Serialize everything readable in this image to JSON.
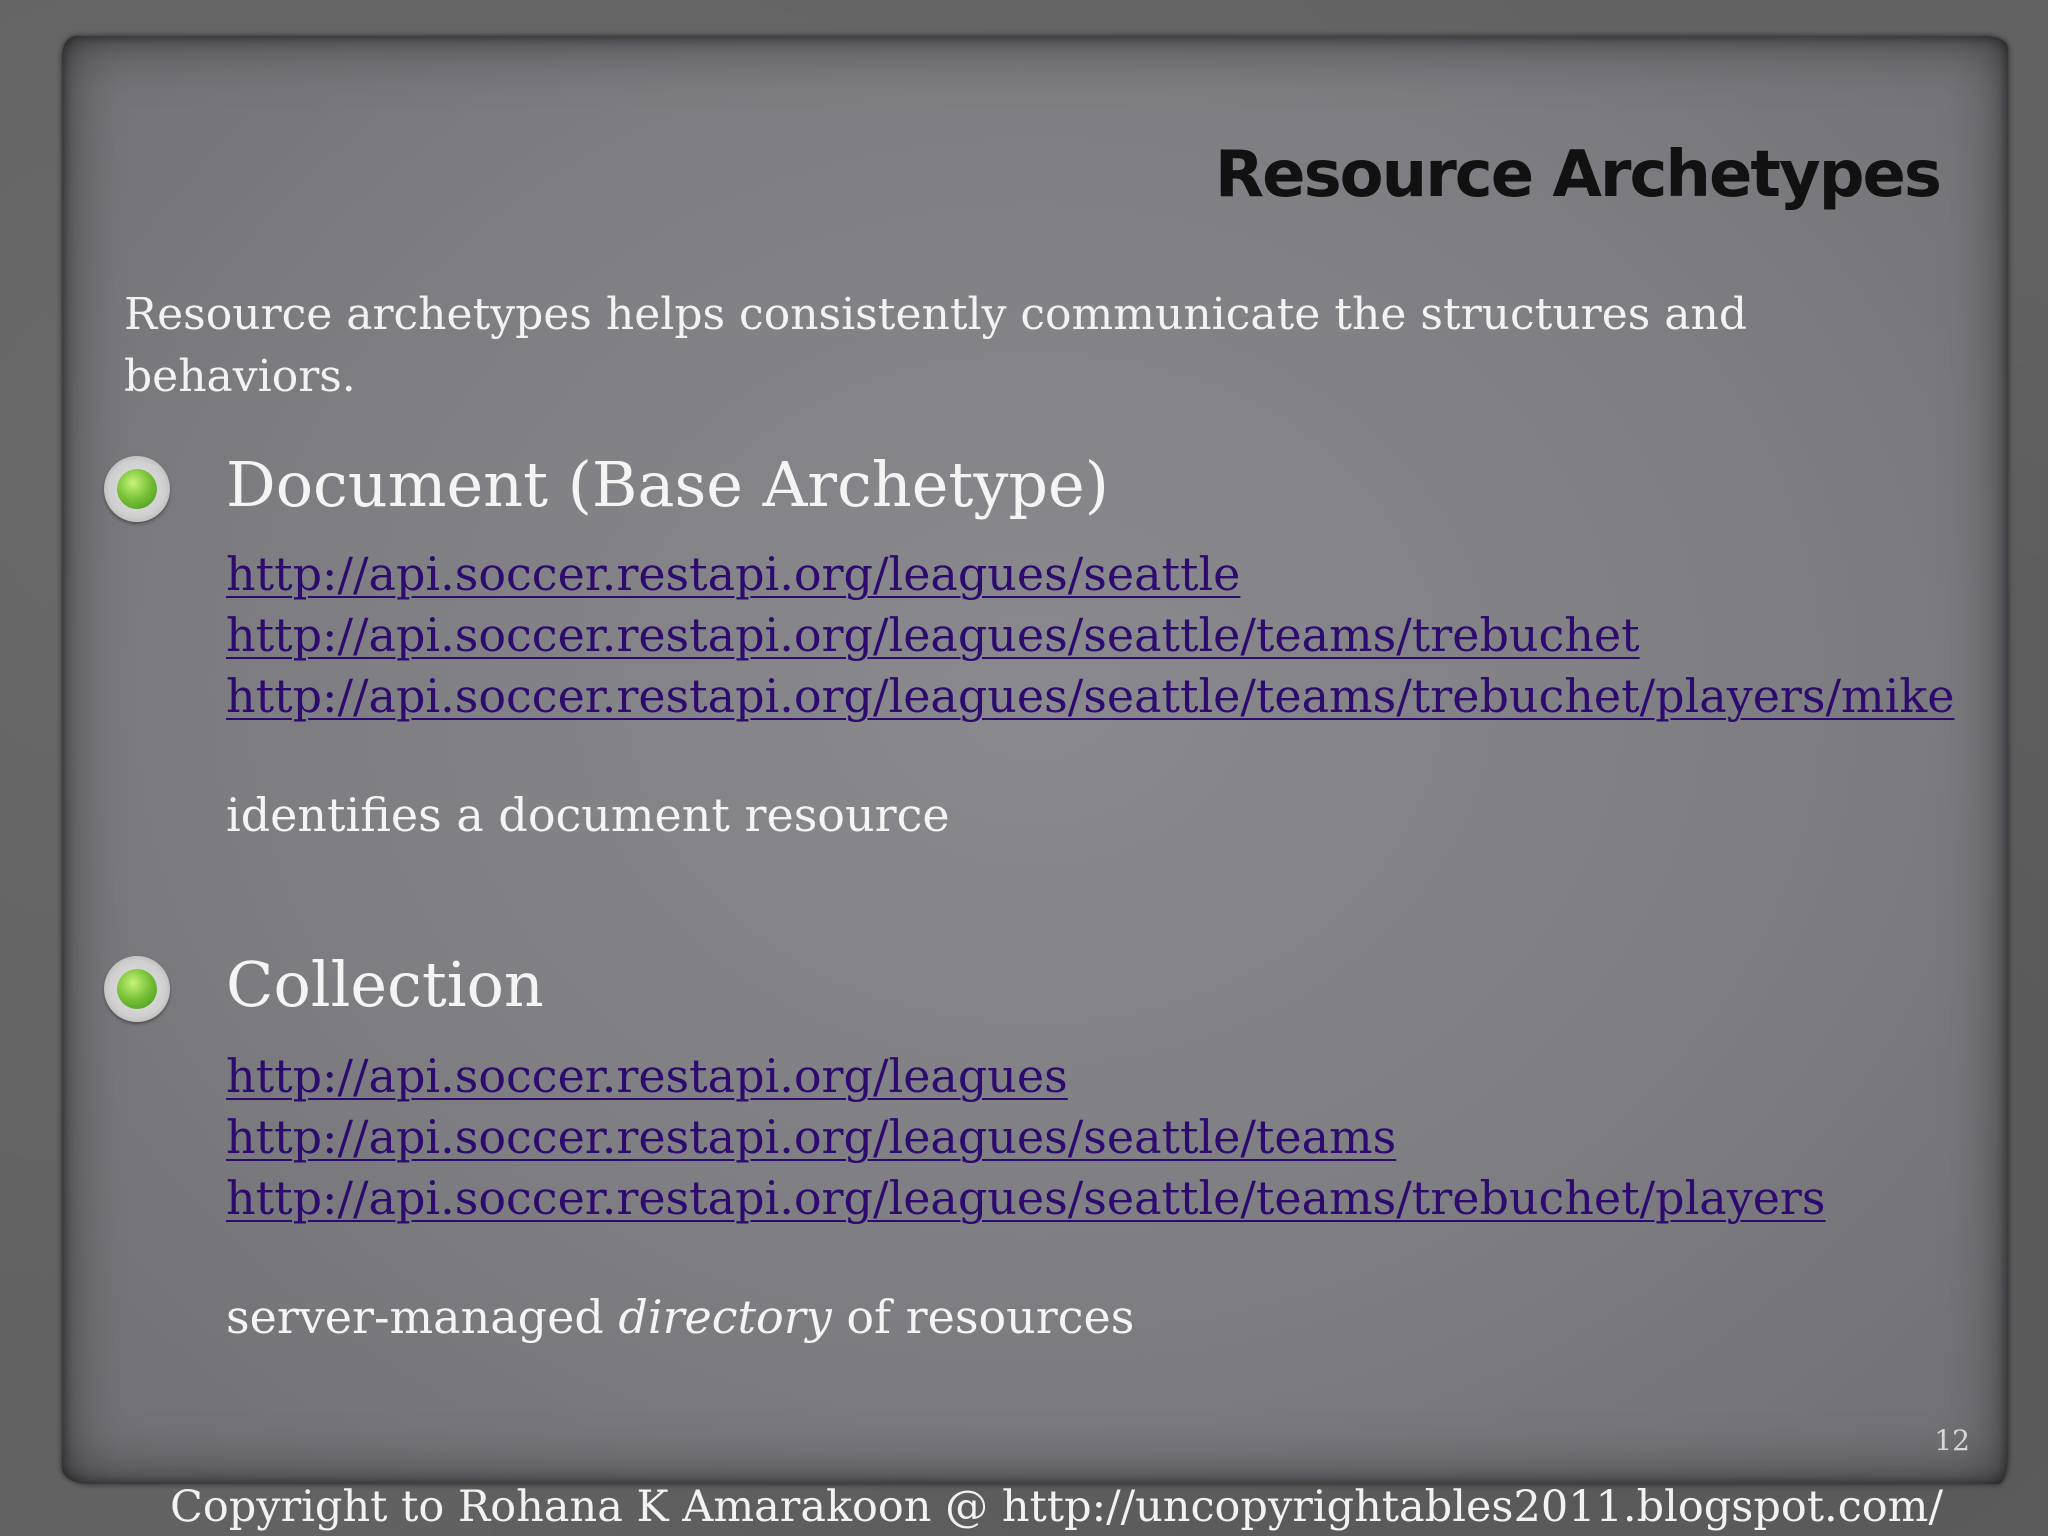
{
  "slide": {
    "title": "Resource Archetypes",
    "intro": "Resource archetypes helps consistently communicate the structures and behaviors.",
    "sections": [
      {
        "heading": "Document  (Base Archetype)",
        "links": [
          "http://api.soccer.restapi.org/leagues/seattle",
          "http://api.soccer.restapi.org/leagues/seattle/teams/trebuchet",
          "http://api.soccer.restapi.org/leagues/seattle/teams/trebuchet/players/mike"
        ],
        "note": "identifies a document resource"
      },
      {
        "heading": "Collection",
        "links": [
          "http://api.soccer.restapi.org/leagues",
          "http://api.soccer.restapi.org/leagues/seattle/teams",
          "http://api.soccer.restapi.org/leagues/seattle/teams/trebuchet/players"
        ],
        "note_before": "server-managed ",
        "note_emphasis": "directory",
        "note_after": " of resources"
      }
    ],
    "page_number": "12",
    "footer": "Copyright to Rohana K Amarakoon @ http://uncopyrightables2011.blogspot.com/"
  },
  "colors": {
    "link": "#2d0a6e",
    "bullet_green": "#7bc43a",
    "text_light": "#f4f4f4",
    "title": "#111111"
  },
  "icons": [
    "green-bullet-icon"
  ]
}
